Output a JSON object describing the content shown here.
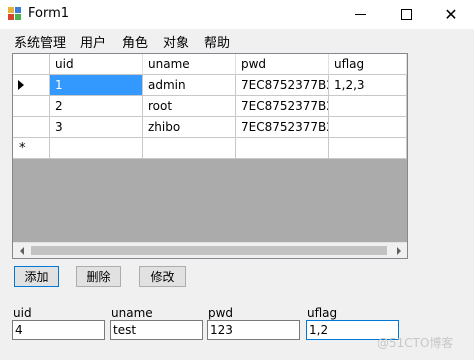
{
  "window": {
    "title": "Form1",
    "close_glyph": "✕"
  },
  "menu": [
    "系统管理",
    "用户",
    "角色",
    "对象",
    "帮助"
  ],
  "grid": {
    "columns": [
      "uid",
      "uname",
      "pwd",
      "uflag"
    ],
    "rows": [
      {
        "uid": "1",
        "uname": "admin",
        "pwd": "7EC8752377B26...",
        "uflag": "1,2,3"
      },
      {
        "uid": "2",
        "uname": "root",
        "pwd": "7EC8752377B26...",
        "uflag": ""
      },
      {
        "uid": "3",
        "uname": "zhibo",
        "pwd": "7EC8752377B26...",
        "uflag": ""
      }
    ],
    "new_row_marker": "*"
  },
  "buttons": {
    "add": "添加",
    "delete": "删除",
    "edit": "修改"
  },
  "form": {
    "uid_label": "uid",
    "uid_value": "4",
    "uname_label": "uname",
    "uname_value": "test",
    "pwd_label": "pwd",
    "pwd_value": "123",
    "uflag_label": "uflag",
    "uflag_value": "1,2"
  },
  "watermark": "@51CTO博客",
  "colors": {
    "selection": "#3399ff",
    "focus_border": "#0078d7",
    "grid_background": "#ababab"
  },
  "icons": [
    "app-icon",
    "minimize-icon",
    "maximize-icon",
    "close-icon",
    "current-row-arrow-icon",
    "scroll-left-icon",
    "scroll-right-icon"
  ]
}
